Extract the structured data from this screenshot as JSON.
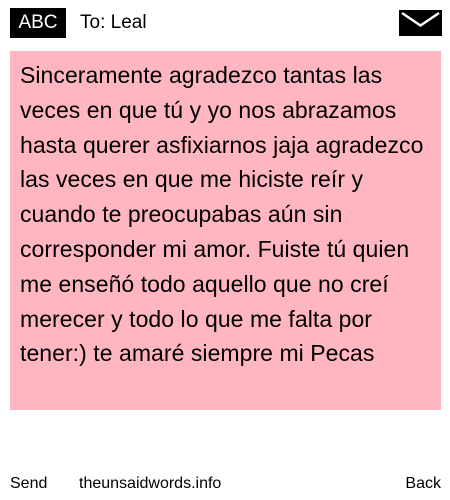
{
  "header": {
    "input_mode": "ABC",
    "recipient": "To: Leal",
    "icon": "envelope-icon"
  },
  "message": {
    "text": "Sinceramente agradezco tantas las veces en que tú y yo nos abrazamos hasta querer asfixiarnos jaja agradezco las veces en que me hiciste reír y cuando te preocupabas aún sin corresponder mi amor. Fuiste tú quien me enseñó todo aquello que no creí merecer y todo lo que me falta por tener:) te amaré siempre mi Pecas",
    "highlight_color": "#ffb6c1"
  },
  "footer": {
    "left_softkey": "Send",
    "center_label": "theunsaidwords.info",
    "right_softkey": "Back"
  }
}
